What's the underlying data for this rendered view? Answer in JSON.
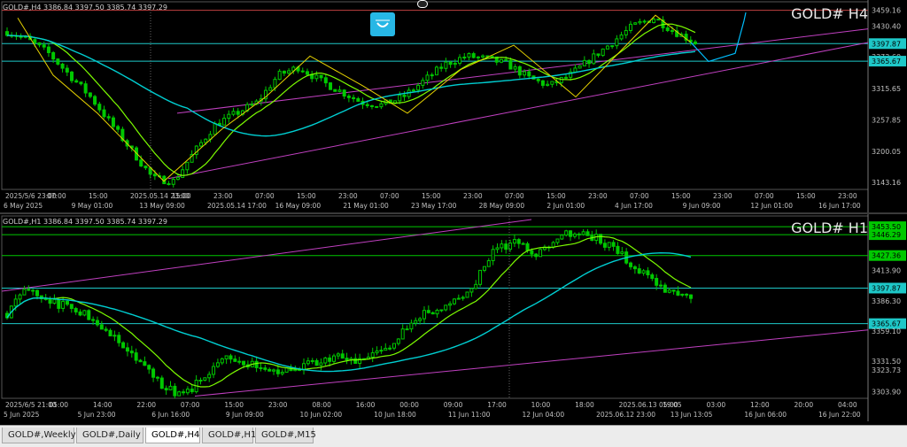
{
  "colors": {
    "bg": "#000000",
    "candle": "#00c800",
    "grid": "#1a1a1a",
    "axis": "#c0c0c0",
    "pink": "#c040c0",
    "cyan": "#00ced1",
    "yellow": "#e6d200",
    "lightgreen": "#7cfc00",
    "hline": "#20b2aa",
    "current": "#1ec8c8"
  },
  "top": {
    "info": "GOLD#,H4  3386.84 3397.50 3385.74 3397.29",
    "watermark": "GOLD# H4",
    "price_labels": [
      {
        "v": "3459.16",
        "y": 3459.16,
        "kind": "plain"
      },
      {
        "v": "3430.40",
        "y": 3430.4,
        "kind": "plain"
      },
      {
        "v": "3397.87",
        "y": 3397.87,
        "kind": "cyanbox"
      },
      {
        "v": "3373.60",
        "y": 3373.6,
        "kind": "plain"
      },
      {
        "v": "3365.67",
        "y": 3365.67,
        "kind": "cyanbox"
      },
      {
        "v": "3315.65",
        "y": 3315.65,
        "kind": "plain"
      },
      {
        "v": "3257.85",
        "y": 3257.85,
        "kind": "plain"
      },
      {
        "v": "3200.05",
        "y": 3200.05,
        "kind": "plain"
      },
      {
        "v": "3143.16",
        "y": 3143.16,
        "kind": "plain"
      }
    ],
    "time_row1": [
      "2025/5/6 23:00",
      "07:00",
      "15:00",
      "2025.05.14 23:00",
      "15:00",
      "23:00",
      "07:00",
      "15:00",
      "23:00",
      "07:00",
      "15:00",
      "23:00",
      "07:00",
      "15:00",
      "23:00",
      "07:00",
      "15:00",
      "23:00",
      "07:00",
      "15:00",
      "23:00"
    ],
    "time_row2": [
      "6 May 2025",
      "9 May 01:00",
      "13 May 09:00",
      "2025.05.14 17:00",
      "16 May 09:00",
      "21 May 01:00",
      "23 May 17:00",
      "28 May 09:00",
      "2 Jun 01:00",
      "4 Jun 17:00",
      "9 Jun 09:00",
      "12 Jun 01:00",
      "16 Jun 17:00"
    ]
  },
  "bottom": {
    "info": "GOLD#,H1  3386.84 3397.50 3385.74 3397.29",
    "watermark": "GOLD# H1",
    "price_labels": [
      {
        "v": "3453.50",
        "y": 3453.5,
        "kind": "greenbox"
      },
      {
        "v": "3446.29",
        "y": 3446.29,
        "kind": "greenbox"
      },
      {
        "v": "3427.36",
        "y": 3427.36,
        "kind": "greenbox"
      },
      {
        "v": "3413.90",
        "y": 3413.9,
        "kind": "plain"
      },
      {
        "v": "3397.87",
        "y": 3397.87,
        "kind": "cyanbox"
      },
      {
        "v": "3386.30",
        "y": 3386.3,
        "kind": "plain"
      },
      {
        "v": "3365.67",
        "y": 3365.67,
        "kind": "cyanbox"
      },
      {
        "v": "3359.10",
        "y": 3359.1,
        "kind": "plain"
      },
      {
        "v": "3331.50",
        "y": 3331.5,
        "kind": "plain"
      },
      {
        "v": "3323.73",
        "y": 3323.73,
        "kind": "plain"
      },
      {
        "v": "3303.90",
        "y": 3303.9,
        "kind": "plain"
      }
    ],
    "time_row1": [
      "2025/6/5 21:00",
      "05:00",
      "14:00",
      "22:00",
      "07:00",
      "15:00",
      "23:00",
      "08:00",
      "16:00",
      "00:00",
      "09:00",
      "17:00",
      "10:00",
      "18:00",
      "2025.06.13 05:00",
      "19:05",
      "03:00",
      "12:00",
      "20:00",
      "04:00"
    ],
    "time_row2": [
      "5 Jun 2025",
      "5 Jun 23:00",
      "6 Jun 16:00",
      "9 Jun 09:00",
      "10 Jun 02:00",
      "10 Jun 18:00",
      "11 Jun 11:00",
      "12 Jun 04:00",
      "2025.06.12 23:00",
      "13 Jun 13:05",
      "16 Jun 06:00",
      "16 Jun 22:00"
    ]
  },
  "tabs": [
    {
      "label": "GOLD#,Weekly",
      "active": false
    },
    {
      "label": "GOLD#,Daily",
      "active": false
    },
    {
      "label": "GOLD#,H4",
      "active": true
    },
    {
      "label": "GOLD#,H1",
      "active": false
    },
    {
      "label": "GOLD#,M15",
      "active": false
    }
  ]
}
